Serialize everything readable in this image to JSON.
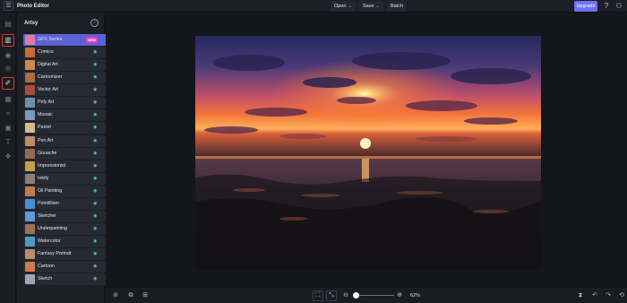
{
  "topbar": {
    "app_title": "Photo Editor",
    "open_label": "Open",
    "save_label": "Save",
    "batch_label": "Batch",
    "upgrade_label": "Upgrade"
  },
  "rail": {
    "tools": [
      "layout-icon",
      "image-effects-icon",
      "eye-icon",
      "shapes-icon",
      "artsy-brush-icon",
      "layers-icon",
      "crop-icon",
      "frame-icon",
      "text-icon",
      "graphics-icon"
    ],
    "highlighted": [
      "image-effects-icon",
      "artsy-brush-icon"
    ]
  },
  "panel": {
    "title": "Artsy",
    "items": [
      {
        "label": "GFX Series",
        "badge": "NEW",
        "active": true,
        "thumb": "#e07aa0"
      },
      {
        "label": "Comics",
        "thumb": "#c86a3a"
      },
      {
        "label": "Digital Art",
        "thumb": "#d08a4a"
      },
      {
        "label": "Cartoonizer",
        "thumb": "#b5683f"
      },
      {
        "label": "Vector Art",
        "thumb": "#a94c3c"
      },
      {
        "label": "Poly Art",
        "thumb": "#6c8fb0"
      },
      {
        "label": "Mosaic",
        "thumb": "#7c9ab8"
      },
      {
        "label": "Pastel",
        "thumb": "#d7b890"
      },
      {
        "label": "Pen Art",
        "thumb": "#c28a66"
      },
      {
        "label": "Gouache",
        "thumb": "#9a6a4c"
      },
      {
        "label": "Impressionist",
        "thumb": "#c2a14a"
      },
      {
        "label": "Inkify",
        "thumb": "#8a7f77"
      },
      {
        "label": "Oil Painting",
        "thumb": "#c07c4a"
      },
      {
        "label": "Pointillism",
        "thumb": "#4a8fcf"
      },
      {
        "label": "Sketcher",
        "thumb": "#5a9ad8"
      },
      {
        "label": "Underpainting",
        "thumb": "#9a7256"
      },
      {
        "label": "Watercolor",
        "thumb": "#4e9ac6"
      },
      {
        "label": "Fantasy Portrait",
        "thumb": "#b88c6a"
      },
      {
        "label": "Cartoon",
        "thumb": "#d27a4c"
      },
      {
        "label": "Sketch",
        "thumb": "#9fa6b2"
      }
    ]
  },
  "bottombar": {
    "zoom_label": "62%"
  },
  "colors": {
    "accent": "#6d73f2",
    "active_item": "#5b62d6",
    "badge": "#e83fbd",
    "highlight_box": "#e0372f"
  }
}
